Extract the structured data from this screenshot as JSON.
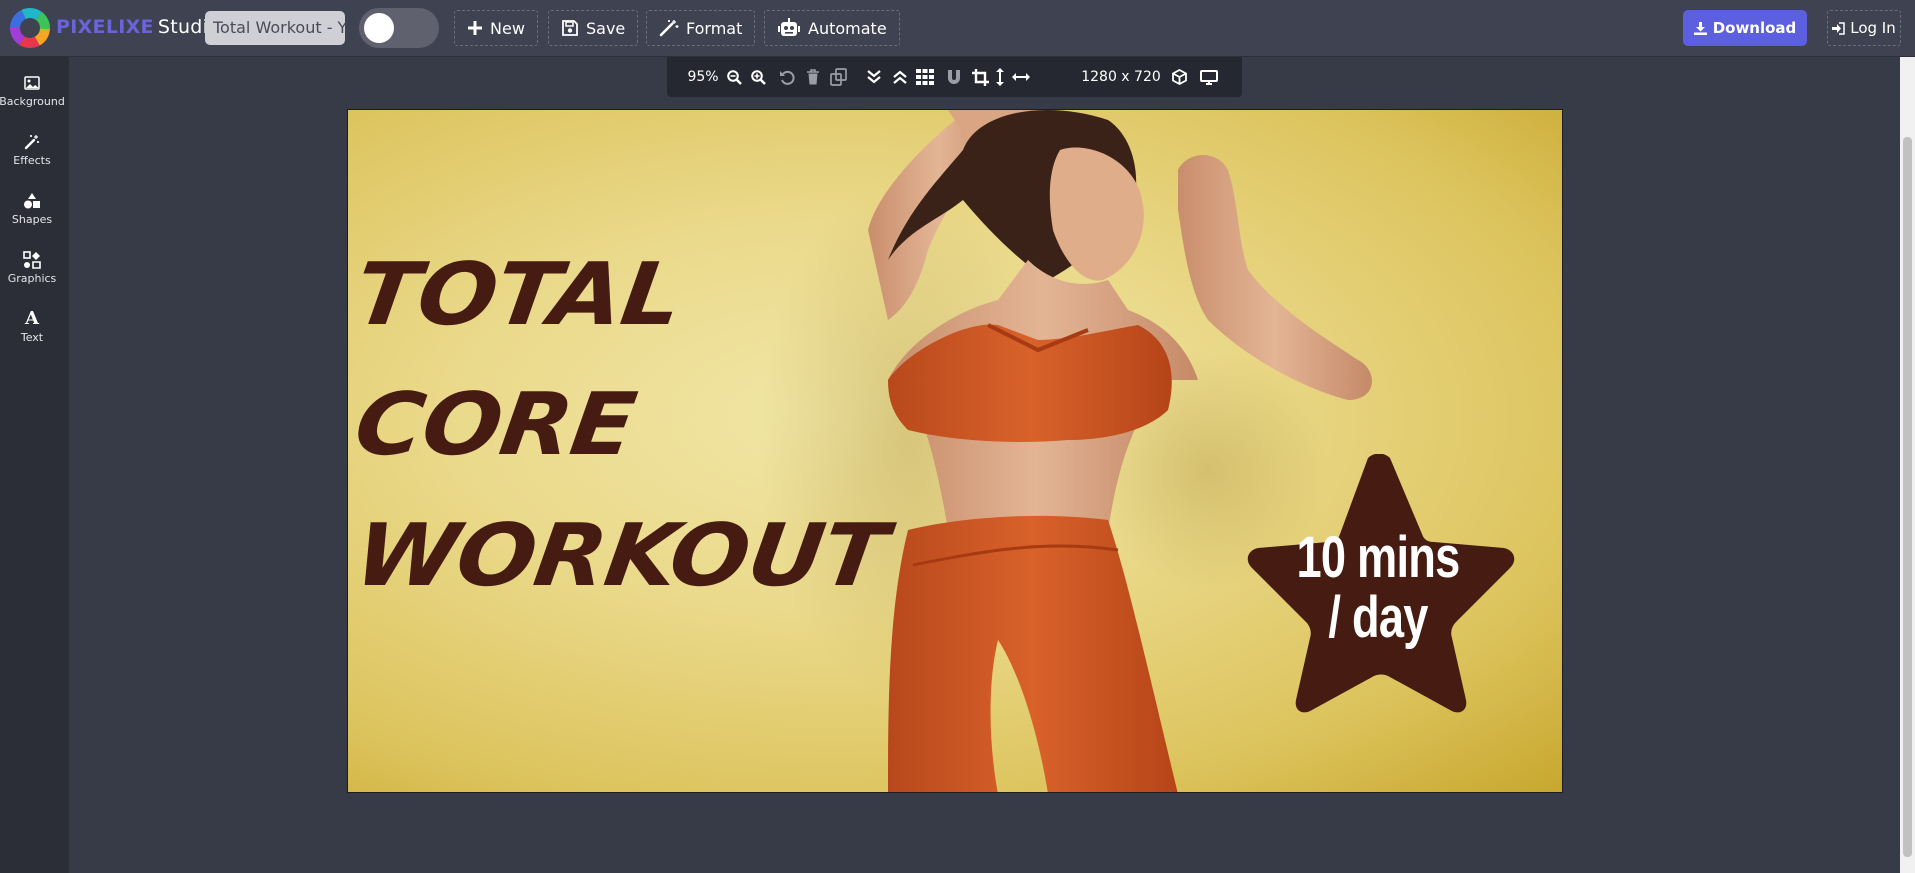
{
  "app": {
    "brand_name": "PIXELIXE",
    "brand_suffix": "Studio",
    "document_title": "Total Workout - YouTube Thumbnail",
    "accent_color": "#5b5fe0"
  },
  "toolbar": {
    "new_label": "New",
    "save_label": "Save",
    "format_label": "Format",
    "automate_label": "Automate",
    "download_label": "Download",
    "login_label": "Log In",
    "toggle_on": false
  },
  "sidebar": {
    "items": [
      {
        "label": "Background",
        "icon": "image-icon"
      },
      {
        "label": "Effects",
        "icon": "magic-wand-icon"
      },
      {
        "label": "Shapes",
        "icon": "shapes-icon"
      },
      {
        "label": "Graphics",
        "icon": "graphics-icon"
      },
      {
        "label": "Text",
        "icon": "text-icon",
        "glyph": "A"
      }
    ]
  },
  "canvas_toolbar": {
    "zoom": "95%",
    "size": "1280 x 720",
    "tools": [
      "zoom-out-icon",
      "zoom-in-icon",
      "undo-icon",
      "delete-icon",
      "duplicate-icon",
      "send-backward-icon",
      "bring-forward-icon",
      "grid-icon",
      "magnet-icon",
      "crop-icon",
      "resize-height-icon",
      "resize-width-icon",
      "3d-box-icon",
      "desktop-icon"
    ]
  },
  "artboard": {
    "headline": [
      "TOTAL",
      "CORE",
      "WORKOUT"
    ],
    "badge_line1": "10 mins",
    "badge_line2": "/ day",
    "text_color": "#461c12",
    "background_color": "#ead98a"
  }
}
